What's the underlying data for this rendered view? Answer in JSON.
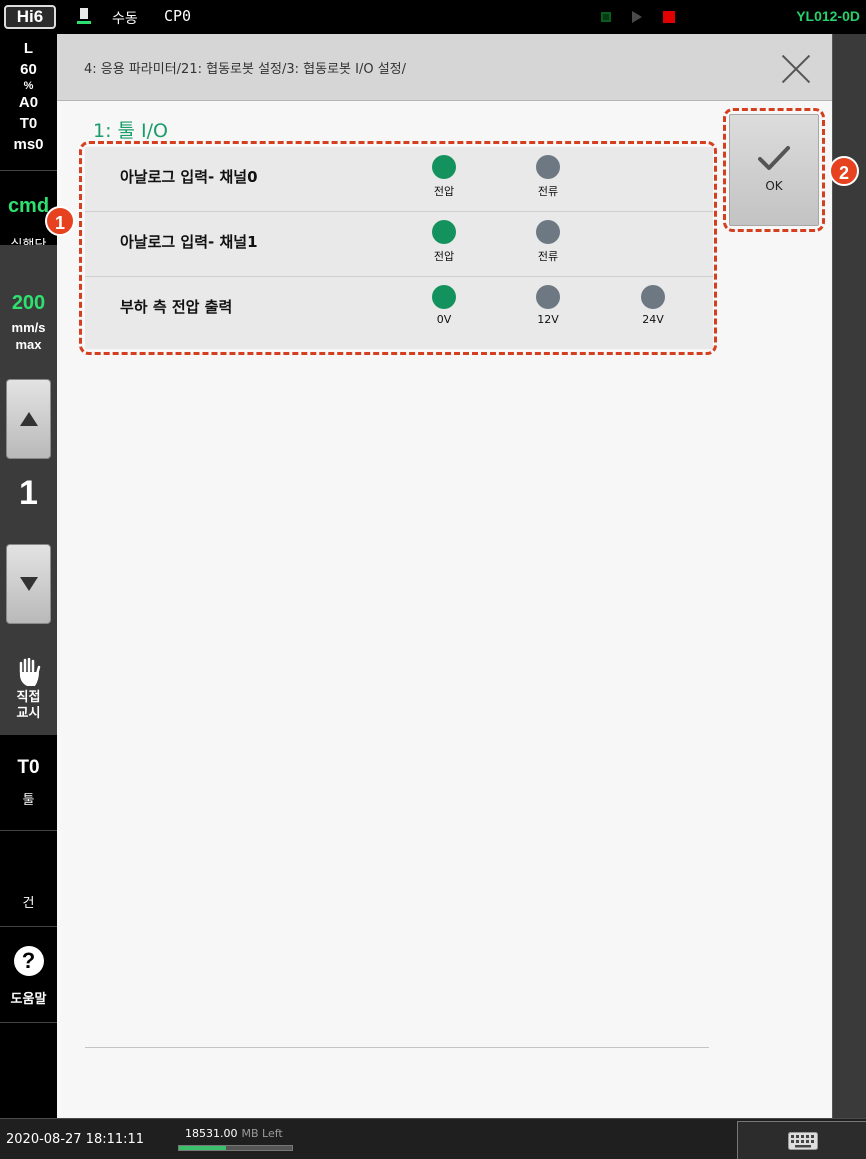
{
  "topbar": {
    "logo": "Hi6",
    "mode": "수동",
    "program": "CP0",
    "version": "YL012-0D",
    "stop_indicator_color": "#e00000"
  },
  "sidebar": {
    "status_lines": [
      "L",
      "60",
      "%",
      "A0",
      "T0",
      "ms0"
    ],
    "cmd": "cmd",
    "cmd_label": "실행단",
    "speed_value": "200",
    "speed_unit": "mm/s",
    "speed_mode": "max",
    "step_value": "1",
    "direct_teach_line1": "직접",
    "direct_teach_line2": "교시",
    "tool_value": "T0",
    "tool_label": "툴",
    "gun_label": "건",
    "help_label": "도움말",
    "icons": [
      "up-arrow-icon",
      "down-arrow-icon",
      "hand-icon",
      "help-icon"
    ]
  },
  "dialog": {
    "breadcrumb": "4: 응용 파라미터/21: 협동로봇 설정/3: 협동로봇 I/O 설정/",
    "section_title": "1: 툴 I/O",
    "ok_label": "OK",
    "accent_color": "#13925e",
    "rows": [
      {
        "label": "아날로그 입력- 채널0",
        "options": [
          {
            "caption": "전압",
            "selected": true
          },
          {
            "caption": "전류",
            "selected": false
          }
        ]
      },
      {
        "label": "아날로그 입력- 채널1",
        "options": [
          {
            "caption": "전압",
            "selected": true
          },
          {
            "caption": "전류",
            "selected": false
          }
        ]
      },
      {
        "label": "부하 측 전압 출력",
        "options": [
          {
            "caption": "0V",
            "selected": true
          },
          {
            "caption": "12V",
            "selected": false
          },
          {
            "caption": "24V",
            "selected": false
          }
        ]
      }
    ]
  },
  "annotations": {
    "badge1": "1",
    "badge2": "2",
    "color": "#d4401f"
  },
  "statusbar": {
    "datetime": "2020-08-27 18:11:11",
    "mem_value": "18531.00",
    "mem_suffix": "MB Left",
    "mem_fill_fraction": 0.42
  }
}
